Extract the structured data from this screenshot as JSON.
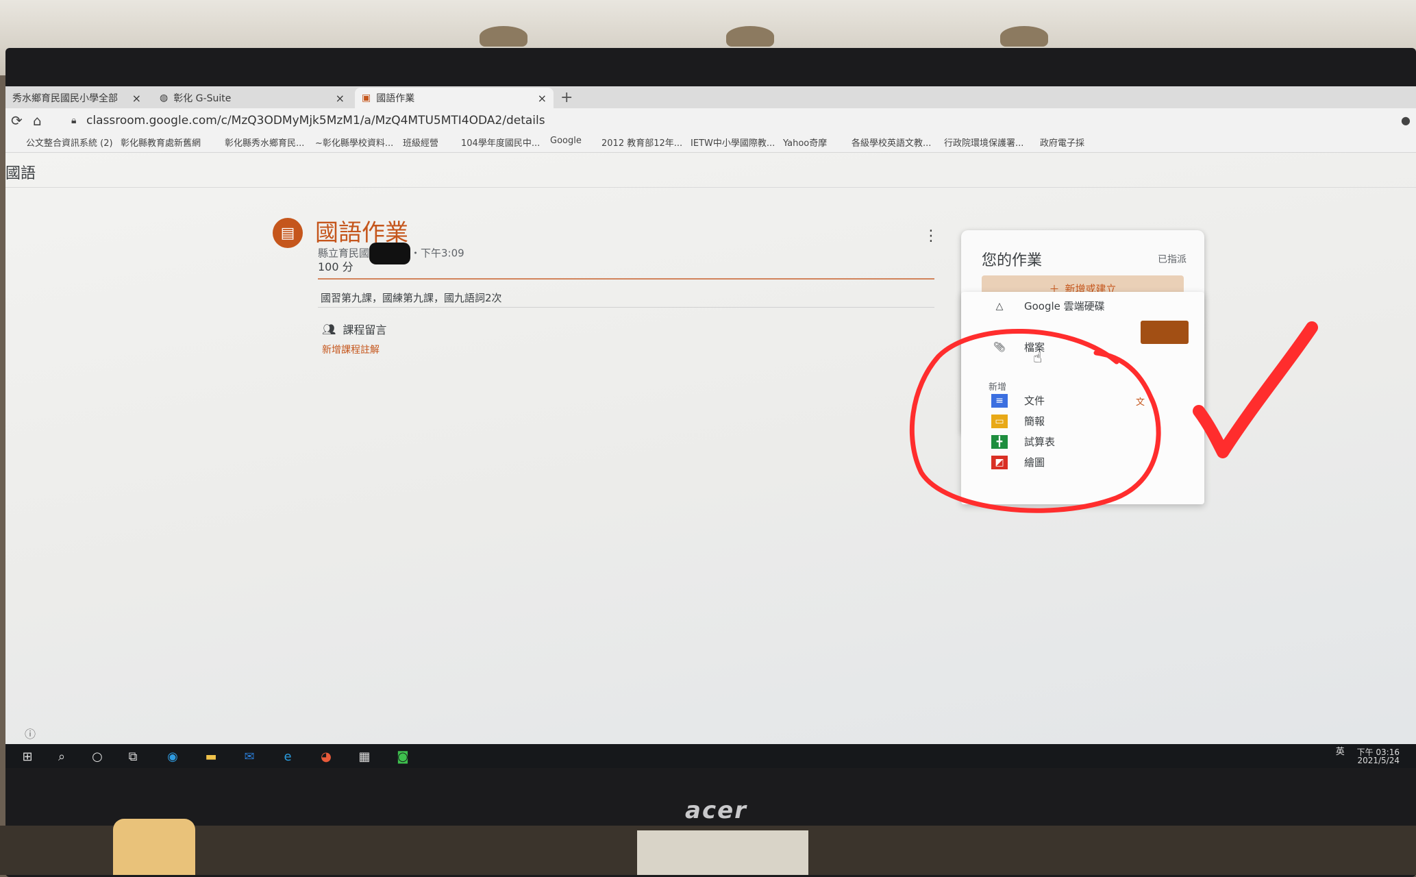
{
  "browser": {
    "tabs": [
      {
        "label": "秀水鄉育民國民小學全部"
      },
      {
        "label": "彰化 G-Suite"
      },
      {
        "label": "國語作業"
      }
    ],
    "new_tab_label": "+",
    "close_label": "×",
    "url": "classroom.google.com/c/MzQ3ODMyMjk5MzM1/a/MzQ4MTU5MTI4ODA2/details",
    "bookmarks": [
      "公文整合資訊系統 (2)",
      "彰化縣教育處新舊網",
      "彰化縣秀水鄉育民...",
      "~彰化縣學校資料...",
      "班級經營",
      "104學年度國民中...",
      "Google",
      "2012 教育部12年...",
      "IETW中小學國際教...",
      "Yahoo奇摩",
      "各級學校英語文教...",
      "行政院環境保護署...",
      "政府電子採"
    ]
  },
  "app": {
    "title": "國語"
  },
  "assignment": {
    "title": "國語作業",
    "author": "縣立育民國",
    "time": "・下午3:09",
    "points": "100 分",
    "description": "國習第九課，國練第九課，國九語詞2次",
    "comments_label": "課程留言",
    "add_comment": "新增課程註解"
  },
  "your_work": {
    "title": "您的作業",
    "status": "已指派",
    "add_button": "新增或建立",
    "items": [
      {
        "label": "Google 雲端硬碟"
      },
      {
        "label": "檔案"
      }
    ],
    "section_new": "新增",
    "new_items": [
      {
        "label": "文件"
      },
      {
        "label": "簡報"
      },
      {
        "label": "試算表"
      },
      {
        "label": "繪圖"
      }
    ],
    "translate_glyph": "文"
  },
  "taskbar": {
    "clock_time": "下午 03:16",
    "clock_date": "2021/5/24",
    "ime": "英"
  },
  "monitor": {
    "brand": "acer"
  },
  "colors": {
    "accent": "#c5561c",
    "annotation": "#ff2d2d"
  }
}
